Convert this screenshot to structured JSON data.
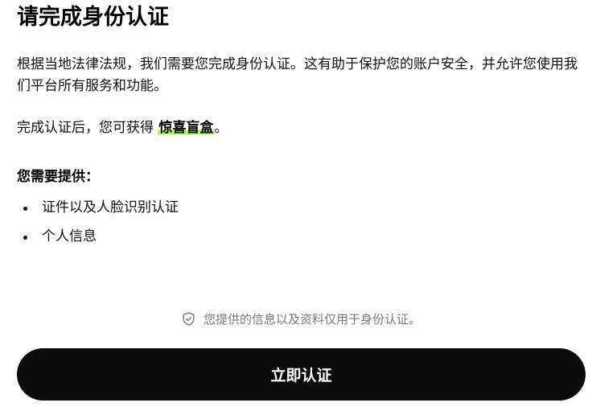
{
  "header": {
    "title": "请完成身份认证"
  },
  "content": {
    "intro": "根据当地法律法规，我们需要您完成身份认证。这有助于保护您的账户安全，并允许您使用我们平台所有服务和功能。",
    "reward_prefix": "完成认证后，您可获得",
    "reward_highlight": "惊喜盲盒",
    "reward_suffix": "。",
    "requirements_heading": "您需要提供：",
    "requirements": [
      "证件以及人脸识别认证",
      "个人信息"
    ]
  },
  "privacy_note": {
    "icon": "shield-check-icon",
    "text": "您提供的信息以及资料仅用于身份认证。"
  },
  "action": {
    "verify_label": "立即认证"
  },
  "colors": {
    "highlight": "#b7f34a",
    "button_background": "#0b0b0b",
    "button_text": "#ffffff",
    "muted_text": "#7a7a7a"
  }
}
